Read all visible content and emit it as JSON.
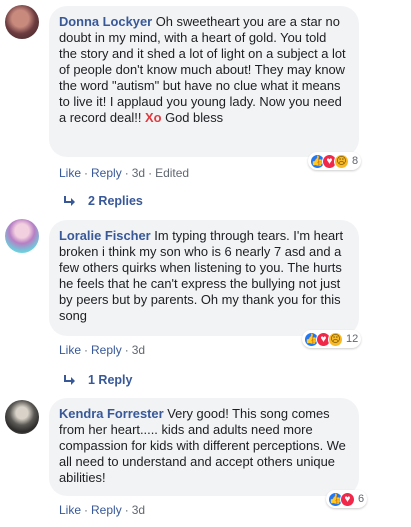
{
  "comments": [
    {
      "author": "Donna Lockyer",
      "text": "Oh sweetheart you are a star no doubt in my mind, with a heart of gold. You told the story and it shed a lot of light on a subject a lot of people don't know much about! They may know the word \"autism\" but have no clue what it means to live it! I applaud you young lady. Now you need a record deal!!",
      "xo": "Xo",
      "signoff": "God bless",
      "reaction_count": "8",
      "reactions": [
        "like-reaction-icon",
        "love-reaction-icon",
        "sad-reaction-icon"
      ],
      "actions": {
        "like": "Like",
        "reply": "Reply",
        "time": "3d",
        "edited": "Edited"
      },
      "replies_label": "2 Replies"
    },
    {
      "author": "Loralie Fischer",
      "text": "Im typing through tears. I'm heart broken i think my son who is 6 nearly 7 asd and a few others quirks when listening to you. The hurts he feels that he can't express the bullying not just by peers but by parents. Oh my thank you for this song",
      "reaction_count": "12",
      "reactions": [
        "like-reaction-icon",
        "love-reaction-icon",
        "sad-reaction-icon"
      ],
      "actions": {
        "like": "Like",
        "reply": "Reply",
        "time": "3d"
      },
      "replies_label": "1 Reply"
    },
    {
      "author": "Kendra Forrester",
      "text": "Very good! This song comes from her heart..... kids and adults need more compassion for kids with different perceptions. We all need to understand and accept others unique abilities!",
      "reaction_count": "6",
      "reactions": [
        "like-reaction-icon",
        "love-reaction-icon"
      ],
      "actions": {
        "like": "Like",
        "reply": "Reply",
        "time": "3d"
      }
    }
  ],
  "colors": {
    "link": "#385898",
    "bubble": "#f2f3f5",
    "meta": "#606770"
  }
}
